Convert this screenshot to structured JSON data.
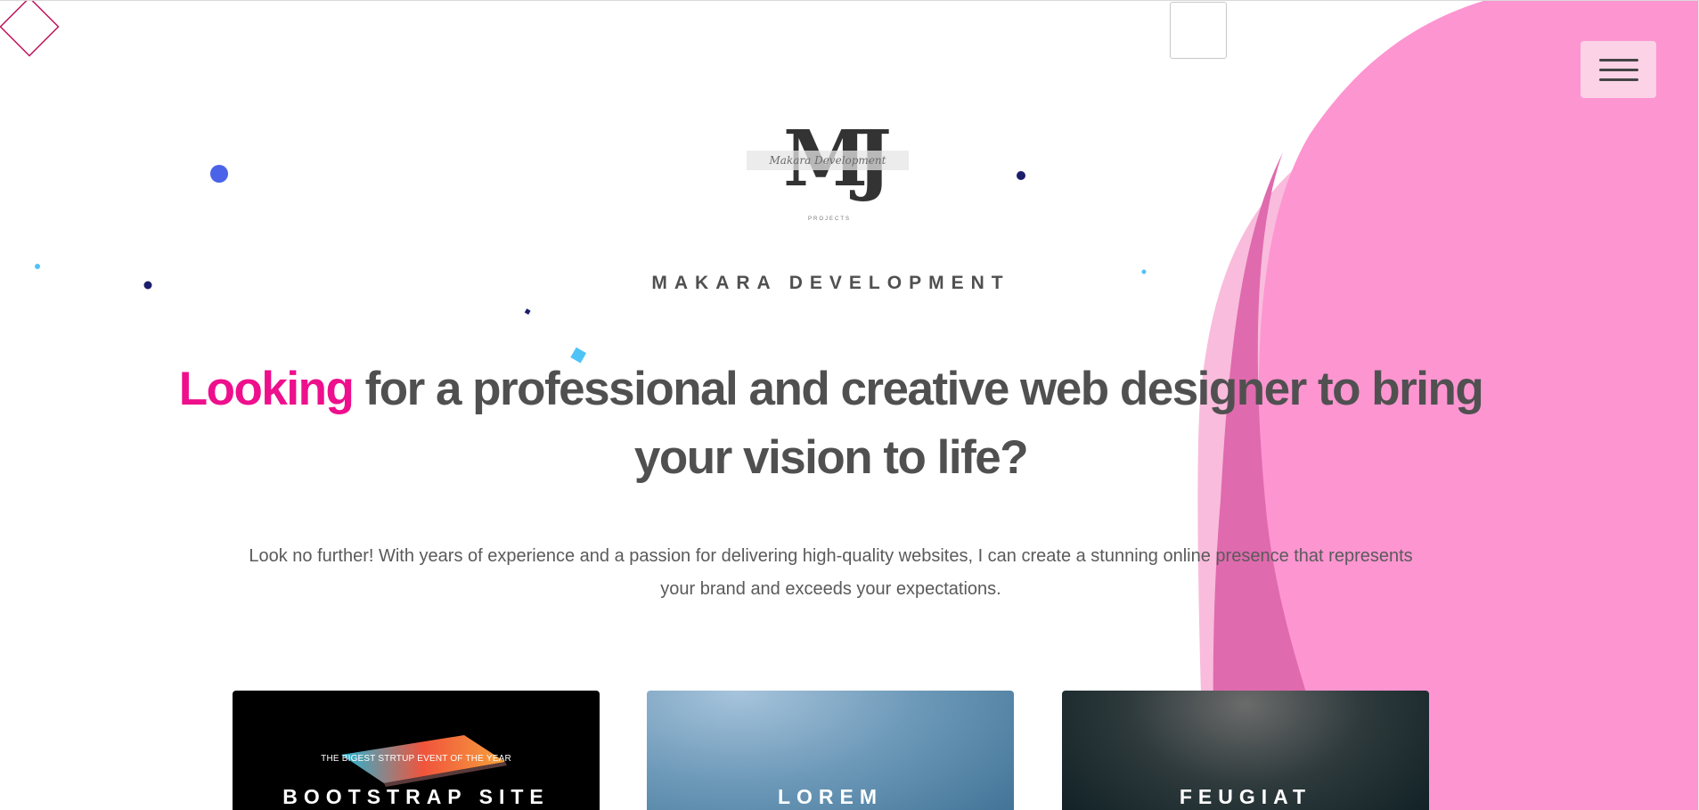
{
  "header": {
    "menu_icon": "hamburger-icon"
  },
  "logo": {
    "monogram": "MJ",
    "script": "Makara Development",
    "subtitle": "PROJECTS"
  },
  "hero": {
    "brand": "MAKARA DEVELOPMENT",
    "headline_accent": "Looking",
    "headline_rest": " for a professional and creative web designer to bring your vision to life?",
    "intro": "Look no further! With years of experience and a passion for delivering high-quality websites, I can create a stunning online presence that represents your brand and exceeds your expectations."
  },
  "cards": [
    {
      "title": "BOOTSTRAP SITE",
      "subtitle": "THE BIGEST STRTUP EVENT OF THE YEAR"
    },
    {
      "title": "LOREM"
    },
    {
      "title": "FEUGIAT"
    }
  ],
  "colors": {
    "accent": "#ee0f8c",
    "blob": "#fd95d1",
    "blob_light": "#f9bcdc",
    "blob_dark": "#e06aae",
    "text": "#505050"
  }
}
